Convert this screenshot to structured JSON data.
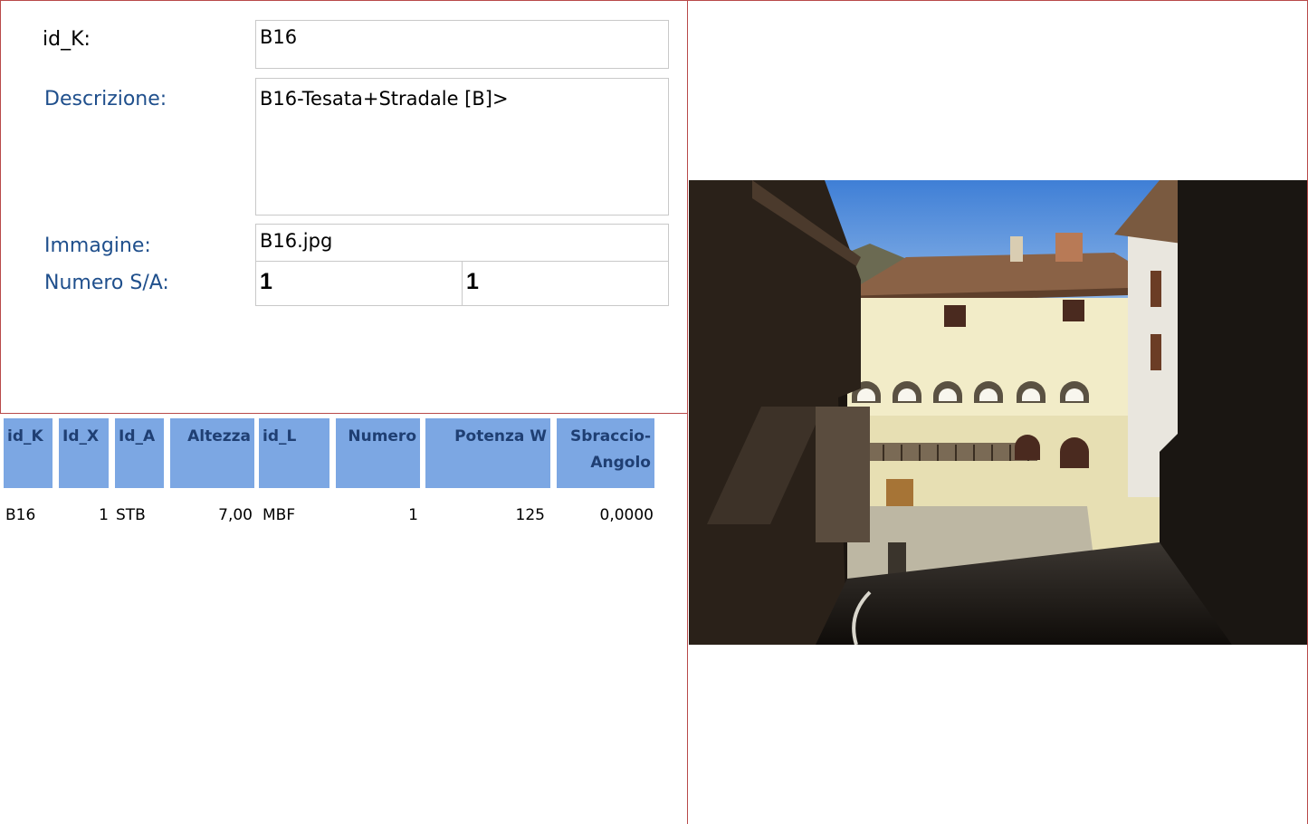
{
  "form": {
    "id_k_label": "id_K:",
    "id_k_value": "B16",
    "descrizione_label": "Descrizione:",
    "descrizione_value": "B16-Tesata+Stradale [B]>",
    "immagine_label": "Immagine:",
    "immagine_value": "B16.jpg",
    "numero_sa_label": "Numero S/A:",
    "numero_s_value": "1",
    "numero_a_value": "1"
  },
  "table": {
    "headers": [
      "id_K",
      "Id_X",
      "Id_A",
      "Altezza",
      "id_L",
      "Numero",
      "Potenza W",
      "Sbraccio-\nAngolo"
    ],
    "rows": [
      [
        "B16",
        "1",
        "STB",
        "7,00",
        "MBF",
        "1",
        "125",
        "0,0000"
      ]
    ]
  },
  "colors": {
    "frame": "#b84a4a",
    "label_blue": "#1f4f8c",
    "header_bg": "#7ca7e3",
    "header_text": "#1f3f73"
  }
}
